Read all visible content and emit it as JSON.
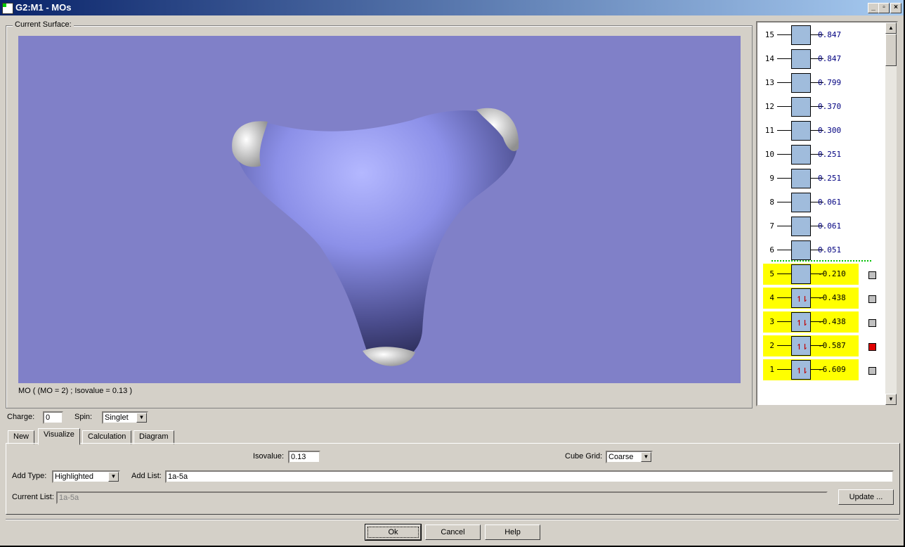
{
  "window": {
    "title": "G2:M1 - MOs",
    "controls": [
      "_",
      "▫",
      "×"
    ]
  },
  "surface": {
    "group_label": "Current Surface:",
    "caption": "MO ( (MO = 2) ; Isovalue = 0.13 )",
    "background": "#8080c8"
  },
  "orbitals": [
    {
      "n": "15",
      "e": "0.847",
      "occ": 0,
      "hl": false
    },
    {
      "n": "14",
      "e": "0.847",
      "occ": 0,
      "hl": false
    },
    {
      "n": "13",
      "e": "0.799",
      "occ": 0,
      "hl": false
    },
    {
      "n": "12",
      "e": "0.370",
      "occ": 0,
      "hl": false
    },
    {
      "n": "11",
      "e": "0.300",
      "occ": 0,
      "hl": false
    },
    {
      "n": "10",
      "e": "0.251",
      "occ": 0,
      "hl": false
    },
    {
      "n": "9",
      "e": "0.251",
      "occ": 0,
      "hl": false
    },
    {
      "n": "8",
      "e": "0.061",
      "occ": 0,
      "hl": false
    },
    {
      "n": "7",
      "e": "0.061",
      "occ": 0,
      "hl": false
    },
    {
      "n": "6",
      "e": "0.051",
      "occ": 0,
      "hl": false
    },
    {
      "n": "5",
      "e": "-0.210",
      "occ": 0,
      "hl": true,
      "selected": false
    },
    {
      "n": "4",
      "e": "-0.438",
      "occ": 2,
      "hl": true,
      "selected": false
    },
    {
      "n": "3",
      "e": "-0.438",
      "occ": 2,
      "hl": true,
      "selected": false
    },
    {
      "n": "2",
      "e": "-0.587",
      "occ": 2,
      "hl": true,
      "selected": true
    },
    {
      "n": "1",
      "e": "-6.609",
      "occ": 2,
      "hl": true,
      "selected": false
    }
  ],
  "charge": {
    "label": "Charge:",
    "value": "0"
  },
  "spin": {
    "label": "Spin:",
    "value": "Singlet"
  },
  "tabs": [
    "New",
    "Visualize",
    "Calculation",
    "Diagram"
  ],
  "active_tab": "Visualize",
  "visualize": {
    "isovalue_label": "Isovalue:",
    "isovalue": "0.13",
    "cube_grid_label": "Cube Grid:",
    "cube_grid": "Coarse",
    "add_type_label": "Add Type:",
    "add_type": "Highlighted",
    "add_list_label": "Add List:",
    "add_list": "1a-5a",
    "current_list_label": "Current List:",
    "current_list": "1a-5a",
    "update_label": "Update ..."
  },
  "buttons": {
    "ok": "Ok",
    "cancel": "Cancel",
    "help": "Help"
  }
}
